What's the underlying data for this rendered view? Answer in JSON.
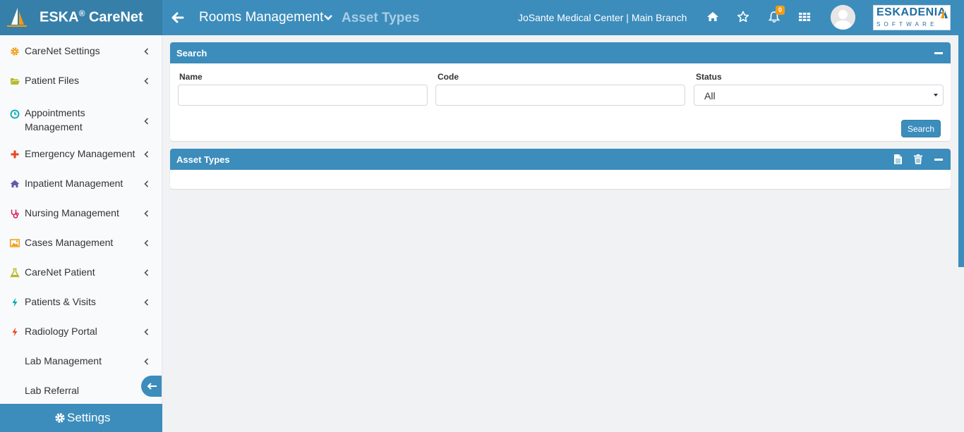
{
  "app": {
    "brand_name": "ESKA",
    "brand_reg": "®",
    "brand_product": " CareNet",
    "module_title": "Rooms Management",
    "page_title": "Asset Types",
    "org_name": "JoSante Medical Center | Main Branch",
    "notification_count": "0",
    "company_logo_top": "ESKADENIA",
    "company_logo_bottom": "SOFTWARE"
  },
  "header_icons": [
    "back-arrow-icon",
    "chevron-down-icon",
    "home-icon",
    "star-icon",
    "bell-icon",
    "grid-icon"
  ],
  "sidebar": {
    "items": [
      {
        "label": "CareNet Settings",
        "icon": "gear-icon",
        "color": "#f39c12"
      },
      {
        "label": "Patient Files",
        "icon": "folder-open-icon",
        "color": "#b5bb24"
      },
      {
        "label": "Appointments Management",
        "icon": "clock-icon",
        "color": "#00a7b5"
      },
      {
        "label": "Emergency Management",
        "icon": "plus-icon",
        "color": "#e8471c"
      },
      {
        "label": "Inpatient Management",
        "icon": "home-icon",
        "color": "#605ca8"
      },
      {
        "label": "Nursing Management",
        "icon": "stethoscope-icon",
        "color": "#d81b60"
      },
      {
        "label": "Cases Management",
        "icon": "image-icon",
        "color": "#f39c12"
      },
      {
        "label": "CareNet Patient",
        "icon": "flask-icon",
        "color": "#b5bb24"
      },
      {
        "label": "Patients & Visits",
        "icon": "bolt-icon",
        "color": "#00a7b5"
      },
      {
        "label": "Radiology Portal",
        "icon": "bolt-icon",
        "color": "#e8471c"
      },
      {
        "label": "Lab Management",
        "icon": "",
        "color": ""
      },
      {
        "label": "Lab Referral",
        "icon": "",
        "color": ""
      }
    ],
    "footer_label": "Settings"
  },
  "search_panel": {
    "title": "Search",
    "name_label": "Name",
    "name_value": "",
    "code_label": "Code",
    "code_value": "",
    "status_label": "Status",
    "status_value": "All",
    "search_button": "Search"
  },
  "results_panel": {
    "title": "Asset Types"
  },
  "colors": {
    "primary": "#3c8dbc",
    "primary_dark": "#367fa9",
    "badge": "#f39c12",
    "page_bg": "#f1f2f4"
  }
}
